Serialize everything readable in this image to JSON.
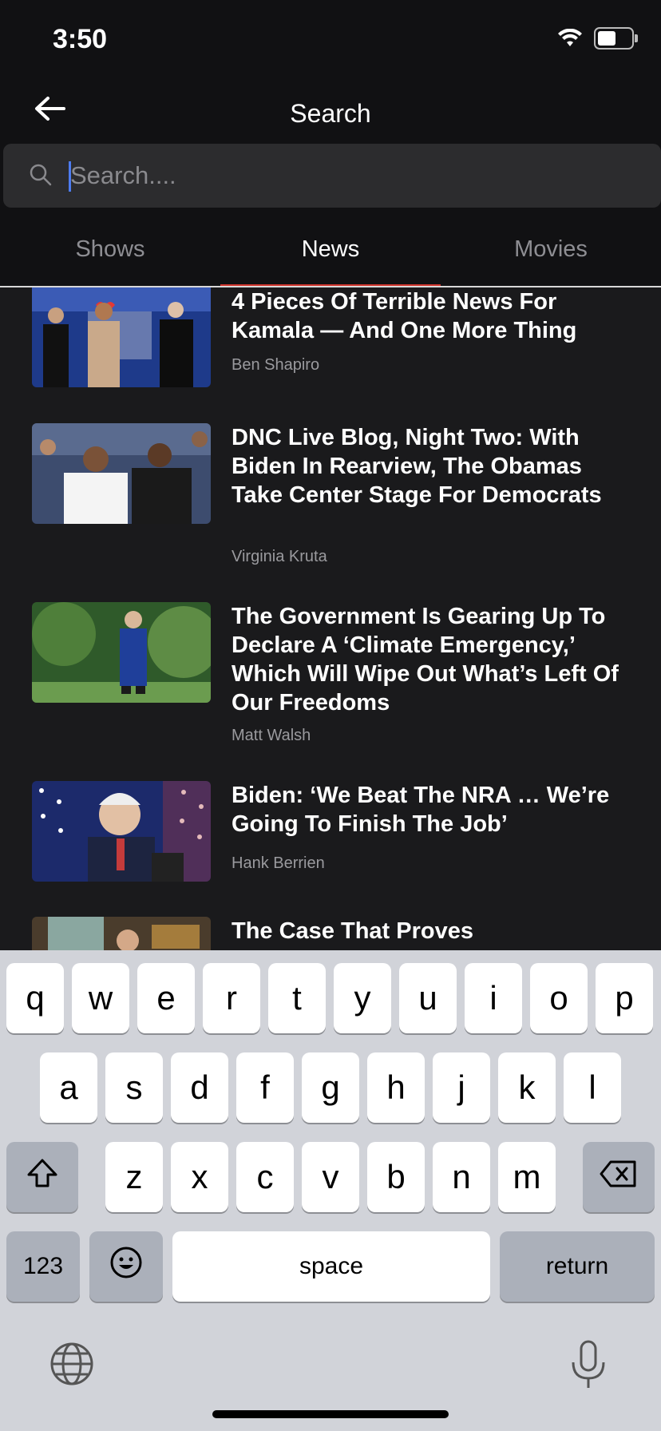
{
  "status": {
    "time": "3:50"
  },
  "header": {
    "title": "Search"
  },
  "search": {
    "placeholder": "Search....",
    "value": ""
  },
  "tabs": [
    {
      "label": "Shows",
      "active": false
    },
    {
      "label": "News",
      "active": true
    },
    {
      "label": "Movies",
      "active": false
    }
  ],
  "news": [
    {
      "title": "4 Pieces Of Terrible News For Kamala — And One More Thing",
      "author": "Ben Shapiro"
    },
    {
      "title": "DNC Live Blog, Night Two: With Biden In Rearview, The Obamas Take Center Stage For Democrats",
      "author": "Virginia Kruta"
    },
    {
      "title": "The Government Is Gearing Up To Declare A ‘Climate Emergency,’ Which Will Wipe Out What’s Left Of Our Freedoms",
      "author": "Matt Walsh"
    },
    {
      "title": "Biden: ‘We Beat The NRA … We’re Going To Finish The Job’",
      "author": "Hank Berrien"
    },
    {
      "title": "The Case That Proves",
      "author": ""
    }
  ],
  "keyboard": {
    "row1": [
      "q",
      "w",
      "e",
      "r",
      "t",
      "y",
      "u",
      "i",
      "o",
      "p"
    ],
    "row2": [
      "a",
      "s",
      "d",
      "f",
      "g",
      "h",
      "j",
      "k",
      "l"
    ],
    "row3": [
      "z",
      "x",
      "c",
      "v",
      "b",
      "n",
      "m"
    ],
    "numbers_label": "123",
    "space_label": "space",
    "return_label": "return"
  },
  "colors": {
    "accent": "#d0342c",
    "background": "#1a1a1c",
    "caret": "#4d7cf0"
  }
}
